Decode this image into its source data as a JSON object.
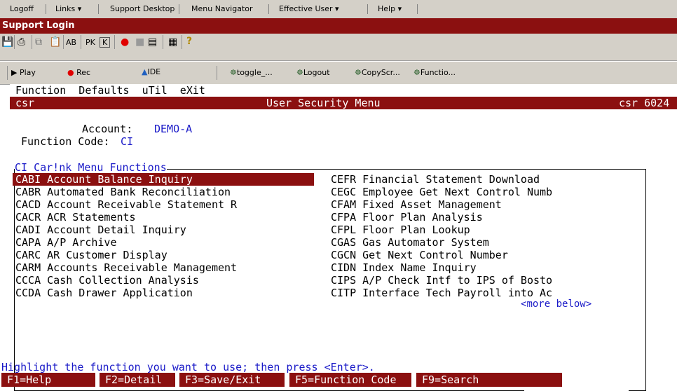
{
  "menubar": {
    "items": [
      "Logoff",
      "Links ▾",
      "Support Desktop",
      "Menu Navigator",
      "Effective User ▾",
      "Help ▾"
    ]
  },
  "title": "Support Login",
  "toolbar2": {
    "play": "Play",
    "rec": "Rec",
    "ide": "IDE",
    "macros": [
      "toggle_...",
      "Logout",
      "CopyScr...",
      "Functio..."
    ]
  },
  "terminal": {
    "menu_line": "Function  Defaults  uTil  eXit",
    "status": {
      "left": "csr",
      "center": "User Security Menu",
      "right": "csr 6024"
    },
    "account_label": "Account:",
    "account_value": "DEMO-A",
    "function_code_label": "Function Code:",
    "function_code_value": "CI",
    "box_title": "CI Car!nk Menu Functions",
    "left_items": [
      "CABI Account Balance Inquiry",
      "CABR Automated Bank Reconciliation",
      "CACD Account Receivable Statement R",
      "CACR ACR Statements",
      "CADI Account Detail Inquiry",
      "CAPA A/P Archive",
      "CARC AR Customer Display",
      "CARM Accounts Receivable Management",
      "CCCA Cash Collection Analysis",
      "CCDA Cash Drawer Application"
    ],
    "right_items": [
      "CEFR Financial Statement Download",
      "CEGC Employee Get Next Control Numb",
      "CFAM Fixed Asset Management",
      "CFPA Floor Plan Analysis",
      "CFPL Floor Plan Lookup",
      "CGAS Gas Automator System",
      "CGCN Get Next Control Number",
      "CIDN Index Name Inquiry",
      "CIPS A/P Check Intf to IPS of Bosto",
      "CITP Interface Tech Payroll into Ac"
    ],
    "more_below": "more below",
    "hint": "Highlight the function you want to use; then press <Enter>.",
    "fkeys": [
      "F1=Help",
      "F2=Detail",
      "F3=Save/Exit",
      "F5=Function Code",
      "F9=Search"
    ]
  },
  "colors": {
    "accent": "#8b1010",
    "term_text": "#1a1ac8",
    "toolbar_bg": "#d4d0c8"
  }
}
